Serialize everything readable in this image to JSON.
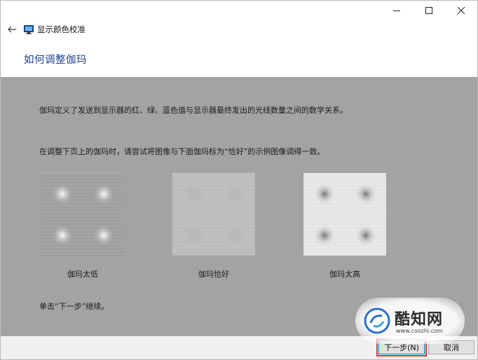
{
  "window": {
    "title": "显示颜色校准",
    "controls": {
      "minimize": "minimize-icon",
      "maximize": "maximize-icon",
      "close": "close-icon"
    }
  },
  "nav": {
    "back_icon": "back-arrow-icon",
    "app_icon": "monitor-icon"
  },
  "page": {
    "heading": "如何调整伽玛",
    "description": "伽玛定义了发送到显示器的红、绿、蓝色值与显示器最终发出的光线数量之间的数学关系。",
    "instruction": "在调整下页上的伽玛时，请尝试将图像与下面伽玛标为“恰好”的示例图像调得一致。",
    "continue_hint": "单击“下一步”继续。"
  },
  "samples": [
    {
      "label": "伽玛太低",
      "kind": "low"
    },
    {
      "label": "伽玛恰好",
      "kind": "good"
    },
    {
      "label": "伽玛太高",
      "kind": "high"
    }
  ],
  "buttons": {
    "next": "下一步(N)",
    "cancel": "取消"
  },
  "watermark": {
    "text": "酷知网",
    "url": "www.coozhi.com"
  },
  "colors": {
    "content_bg": "#a3a3a3",
    "heading": "#1c3f8a",
    "highlight": "#d63a3a"
  }
}
